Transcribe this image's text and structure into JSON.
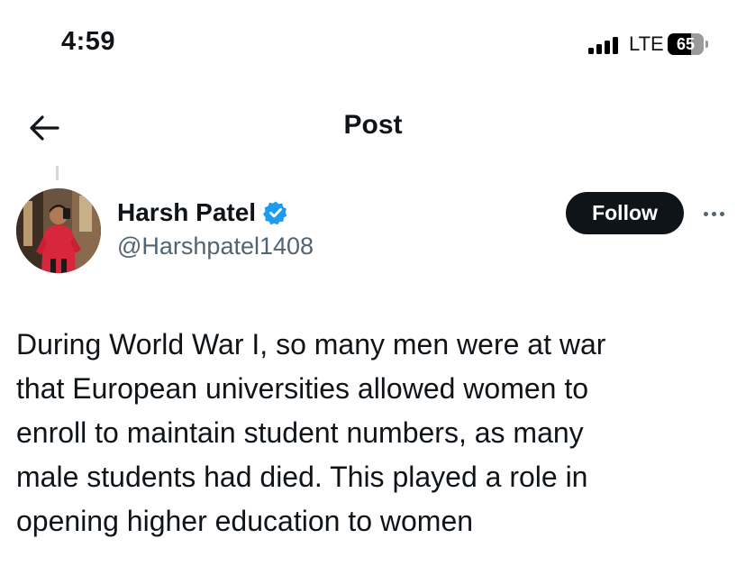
{
  "status_bar": {
    "time": "4:59",
    "network": "LTE",
    "battery": "65",
    "battery_level": 0.65
  },
  "nav": {
    "title": "Post",
    "back_icon": "arrow-left-icon"
  },
  "post": {
    "author": {
      "display_name": "Harsh Patel",
      "handle": "@Harshpatel1408",
      "verified": true,
      "verified_color": "#1d9bf0"
    },
    "follow_label": "Follow",
    "more_icon": "more-horizontal-icon",
    "text": "During World War I, so many men were at war\nthat European universities allowed women to\nenroll to maintain student numbers, as many\nmale students had died. This played a role in\nopening higher education to women"
  },
  "colors": {
    "text": "#0f1419",
    "secondary": "#536471",
    "button": "#0f1419",
    "accent": "#1d9bf0"
  }
}
